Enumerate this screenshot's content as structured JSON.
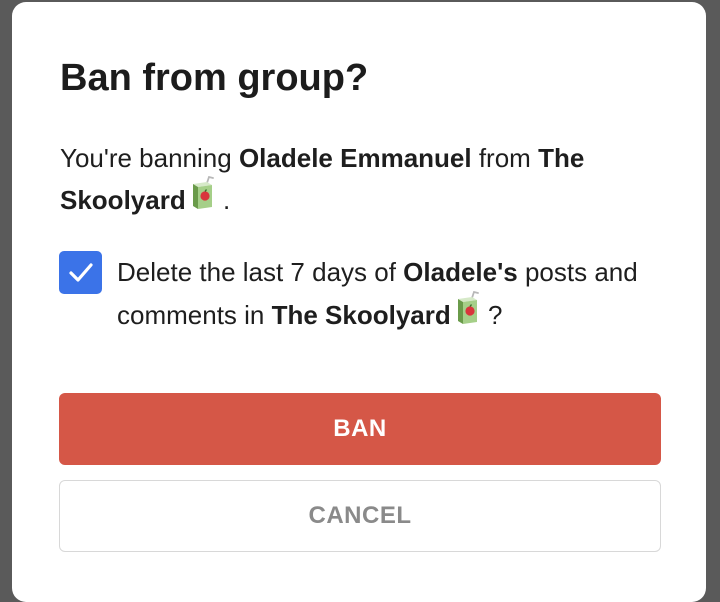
{
  "dialog": {
    "title": "Ban from group?",
    "message": {
      "prefix": "You're banning ",
      "user_name": "Oladele Emmanuel",
      "middle": " from ",
      "group_name": "The Skoolyard",
      "suffix": "."
    },
    "delete_option": {
      "checked": true,
      "prefix": "Delete the last 7 days of ",
      "user_possessive": "Oladele's",
      "middle": " posts and comments in ",
      "group_name": "The Skoolyard",
      "suffix": "?"
    },
    "group_icon": "juice-box-emoji-icon",
    "ban_label": "BAN",
    "cancel_label": "CANCEL"
  },
  "colors": {
    "overlay": "#5a5a5a",
    "dialog_bg": "#ffffff",
    "primary_danger": "#d55747",
    "checkbox": "#3b73e8",
    "cancel_text": "#8a8a8a"
  }
}
